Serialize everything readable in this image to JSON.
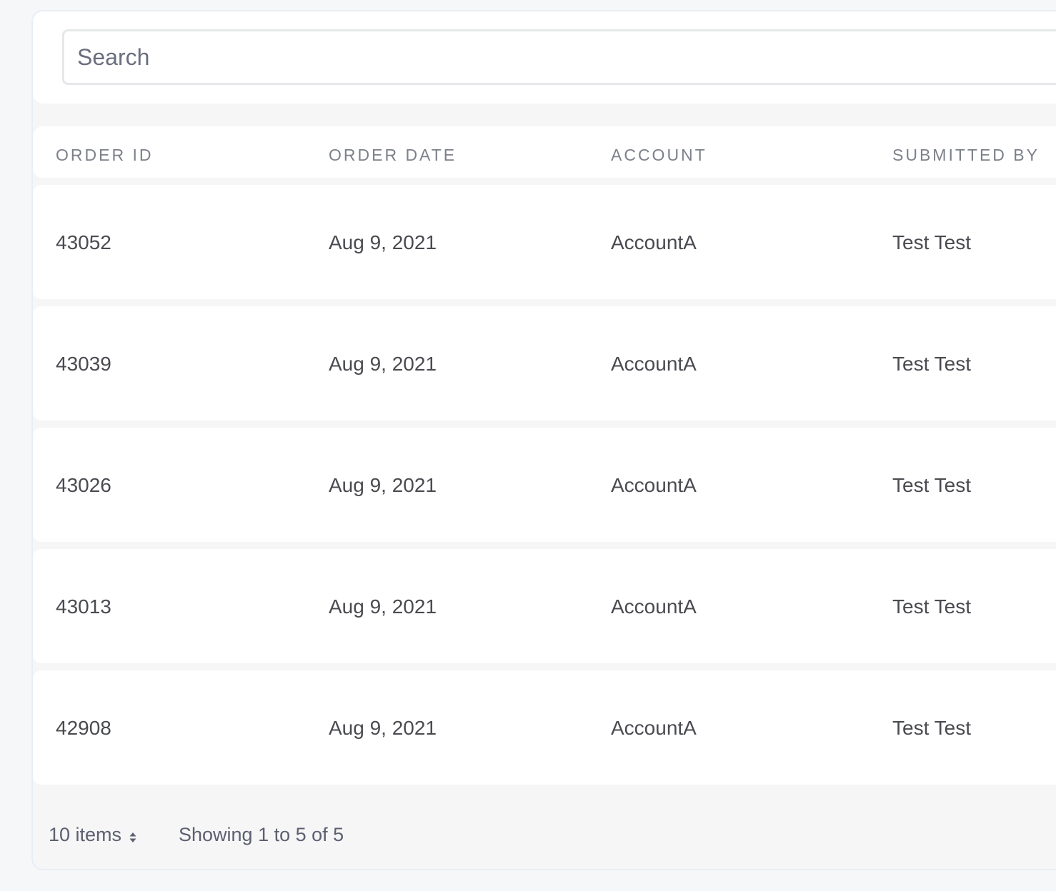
{
  "search": {
    "placeholder": "Search",
    "value": ""
  },
  "table": {
    "columns": [
      "ORDER ID",
      "ORDER DATE",
      "ACCOUNT",
      "SUBMITTED BY"
    ],
    "rows": [
      {
        "order_id": "43052",
        "order_date": "Aug 9, 2021",
        "account": "AccountA",
        "submitted_by": "Test Test"
      },
      {
        "order_id": "43039",
        "order_date": "Aug 9, 2021",
        "account": "AccountA",
        "submitted_by": "Test Test"
      },
      {
        "order_id": "43026",
        "order_date": "Aug 9, 2021",
        "account": "AccountA",
        "submitted_by": "Test Test"
      },
      {
        "order_id": "43013",
        "order_date": "Aug 9, 2021",
        "account": "AccountA",
        "submitted_by": "Test Test"
      },
      {
        "order_id": "42908",
        "order_date": "Aug 9, 2021",
        "account": "AccountA",
        "submitted_by": "Test Test"
      }
    ]
  },
  "footer": {
    "page_size_label": "10 items",
    "page_size_icon": "sort-arrows-icon",
    "showing_text": "Showing 1 to 5 of 5"
  },
  "colors": {
    "background": "#f6f7f8",
    "card": "#ffffff",
    "header_text": "#7c8089",
    "cell_text": "#4a4b50",
    "muted_text": "#5c6070"
  }
}
